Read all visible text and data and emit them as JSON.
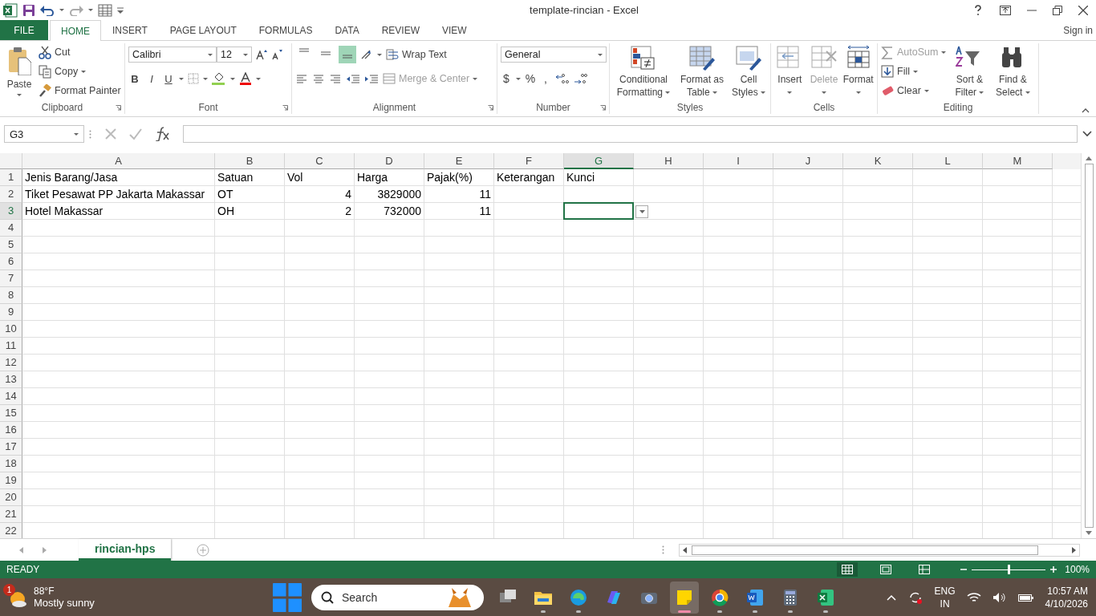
{
  "title_bar": {
    "title": "template-rincian - Excel",
    "sign_in": "Sign in"
  },
  "tabs": [
    {
      "label": "FILE",
      "kind": "file",
      "selected": false
    },
    {
      "label": "HOME",
      "kind": "tab",
      "selected": true
    },
    {
      "label": "INSERT",
      "kind": "tab",
      "selected": false
    },
    {
      "label": "PAGE LAYOUT",
      "kind": "tab",
      "selected": false
    },
    {
      "label": "FORMULAS",
      "kind": "tab",
      "selected": false
    },
    {
      "label": "DATA",
      "kind": "tab",
      "selected": false
    },
    {
      "label": "REVIEW",
      "kind": "tab",
      "selected": false
    },
    {
      "label": "VIEW",
      "kind": "tab",
      "selected": false
    }
  ],
  "ribbon": [
    {
      "kind": "clipboard",
      "label": "Clipboard",
      "paste": "Paste",
      "items": [
        {
          "kind": "cut",
          "label": "Cut"
        },
        {
          "kind": "copy",
          "label": "Copy"
        },
        {
          "kind": "painter",
          "label": "Format Painter"
        }
      ]
    },
    {
      "kind": "font",
      "label": "Font",
      "font_name": "Calibri",
      "font_size": "12",
      "format_buttons": [
        "B",
        "I",
        "U"
      ]
    },
    {
      "kind": "alignment",
      "label": "Alignment",
      "vertical": [
        {
          "selected": false
        },
        {
          "selected": false
        },
        {
          "selected": true
        }
      ],
      "wrap": "Wrap Text",
      "merge": {
        "label": "Merge & Center",
        "disabled": true
      }
    },
    {
      "kind": "number",
      "label": "Number",
      "format": "General",
      "symbols": [
        "$",
        "%",
        ","
      ]
    },
    {
      "kind": "styles",
      "label": "Styles",
      "buttons": [
        {
          "kind": "conditional",
          "label": "Conditional Formatting"
        },
        {
          "kind": "table",
          "label": "Format as Table"
        },
        {
          "kind": "cellstyles",
          "label": "Cell Styles"
        }
      ]
    },
    {
      "kind": "cells",
      "label": "Cells",
      "buttons": [
        {
          "kind": "insert",
          "label": "Insert",
          "disabled": false
        },
        {
          "kind": "delete",
          "label": "Delete",
          "disabled": true
        },
        {
          "kind": "format",
          "label": "Format",
          "disabled": false
        }
      ]
    },
    {
      "kind": "editing",
      "label": "Editing",
      "small": [
        {
          "kind": "autosum",
          "label": "AutoSum",
          "disabled": true
        },
        {
          "kind": "fill",
          "label": "Fill",
          "disabled": false
        },
        {
          "kind": "clear",
          "label": "Clear",
          "disabled": false
        }
      ],
      "large": [
        {
          "kind": "sort",
          "label": "Sort & Filter"
        },
        {
          "kind": "find",
          "label": "Find & Select"
        }
      ]
    }
  ],
  "formula_bar": {
    "name_box": "G3"
  },
  "sheet": {
    "columns": [
      {
        "label": "A",
        "selected": false
      },
      {
        "label": "B",
        "selected": false
      },
      {
        "label": "C",
        "selected": false
      },
      {
        "label": "D",
        "selected": false
      },
      {
        "label": "E",
        "selected": false
      },
      {
        "label": "F",
        "selected": false
      },
      {
        "label": "G",
        "selected": true
      },
      {
        "label": "H",
        "selected": false
      },
      {
        "label": "I",
        "selected": false
      },
      {
        "label": "J",
        "selected": false
      },
      {
        "label": "K",
        "selected": false
      },
      {
        "label": "L",
        "selected": false
      },
      {
        "label": "M",
        "selected": false
      }
    ],
    "rows": [
      {
        "label": "1",
        "selected": false,
        "cells": [
          {
            "kind": "text",
            "text": "Jenis Barang/Jasa"
          },
          {
            "kind": "text",
            "text": "Satuan"
          },
          {
            "kind": "text",
            "text": "Vol"
          },
          {
            "kind": "text",
            "text": "Harga"
          },
          {
            "kind": "text",
            "text": "Pajak(%)"
          },
          {
            "kind": "text",
            "text": "Keterangan"
          },
          {
            "kind": "text",
            "text": "Kunci"
          }
        ]
      },
      {
        "label": "2",
        "selected": false,
        "cells": [
          {
            "kind": "text",
            "text": "Tiket Pesawat PP Jakarta Makassar"
          },
          {
            "kind": "text",
            "text": "OT"
          },
          {
            "kind": "number",
            "text": "4"
          },
          {
            "kind": "number",
            "text": "3829000"
          },
          {
            "kind": "number",
            "text": "11"
          }
        ]
      },
      {
        "label": "3",
        "selected": true,
        "cells": [
          {
            "kind": "text",
            "text": "Hotel Makassar"
          },
          {
            "kind": "text",
            "text": "OH"
          },
          {
            "kind": "number",
            "text": "2"
          },
          {
            "kind": "number",
            "text": "732000"
          },
          {
            "kind": "number",
            "text": "11"
          }
        ]
      },
      {
        "label": "4",
        "selected": false
      },
      {
        "label": "5",
        "selected": false
      },
      {
        "label": "6",
        "selected": false
      },
      {
        "label": "7",
        "selected": false
      },
      {
        "label": "8",
        "selected": false
      },
      {
        "label": "9",
        "selected": false
      },
      {
        "label": "10",
        "selected": false
      },
      {
        "label": "11",
        "selected": false
      },
      {
        "label": "12",
        "selected": false
      },
      {
        "label": "13",
        "selected": false
      },
      {
        "label": "14",
        "selected": false
      },
      {
        "label": "15",
        "selected": false
      },
      {
        "label": "16",
        "selected": false
      },
      {
        "label": "17",
        "selected": false
      },
      {
        "label": "18",
        "selected": false
      },
      {
        "label": "19",
        "selected": false
      },
      {
        "label": "20",
        "selected": false
      },
      {
        "label": "21",
        "selected": false
      },
      {
        "label": "22",
        "selected": false
      }
    ]
  },
  "sheet_tabs": [
    {
      "label": "rincian-hps",
      "selected": true
    }
  ],
  "status_bar": {
    "status": "READY",
    "zoom": "100%",
    "zoom_level": {
      "level": 0.5
    }
  },
  "taskbar": {
    "weather": {
      "badge": "1",
      "temperature": "88°F",
      "condition": "Mostly sunny"
    },
    "search_placeholder": "Search",
    "apps": [
      {
        "kind": "taskview",
        "open": false
      },
      {
        "kind": "folder",
        "open": true
      },
      {
        "kind": "edge",
        "open": true
      },
      {
        "kind": "copilot",
        "open": false
      },
      {
        "kind": "camera",
        "open": false
      },
      {
        "kind": "notes",
        "open": true,
        "selected": true
      },
      {
        "kind": "chrome",
        "open": true,
        "selected": false
      },
      {
        "kind": "word",
        "open": true,
        "selected": false
      },
      {
        "kind": "calculator",
        "open": true,
        "selected": false
      },
      {
        "kind": "excel",
        "open": true,
        "selected": false
      }
    ],
    "language": "ENG",
    "region": "IN",
    "time": "10:57 AM",
    "date": "4/10/2026"
  }
}
